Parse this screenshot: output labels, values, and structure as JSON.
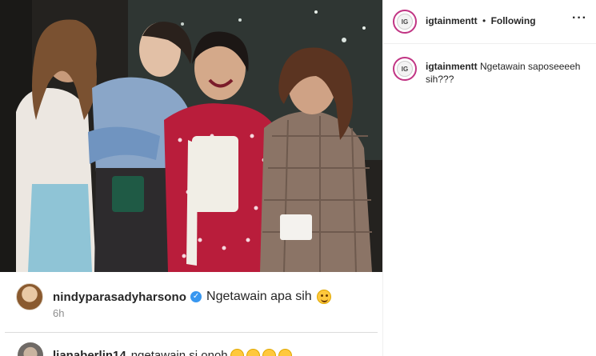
{
  "post": {
    "account": "igtainmentt",
    "follow_status": "Following",
    "separator": "•",
    "more_icon": "more-horizontal-icon",
    "caption": "Ngetawain saposeeeeh sih???"
  },
  "overlay_comments": [
    {
      "user": "nindyparasadyharsono",
      "verified": true,
      "text": "Ngetawain apa sih",
      "emoji": "smiling-face-icon",
      "time": "6h"
    },
    {
      "user": "lianaberlin14",
      "text": "ngetawain si onoh",
      "emoji": "tears-of-joy-face-icon"
    }
  ]
}
